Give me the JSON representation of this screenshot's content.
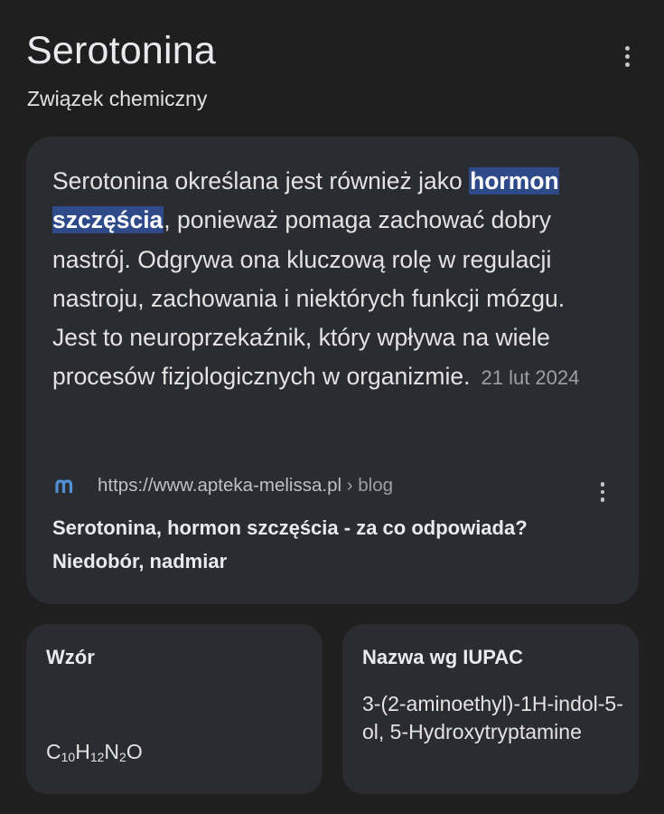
{
  "header": {
    "title": "Serotonina",
    "subtitle": "Związek chemiczny",
    "more_icon": "more-vert-icon"
  },
  "description": {
    "before_highlight": "Serotonina określana jest również jako ",
    "highlight": "hormon szczęścia",
    "after_highlight": ", ponieważ pomaga zachować dobry nastrój. Odgrywa ona kluczową rolę w regulacji nastroju, zachowania i niektórych funkcji mózgu. Jest to neuroprzekaźnik, który wpływa na wiele procesów fizjologicznych w organizmie.",
    "date": "21 lut 2024"
  },
  "source": {
    "logo_icon": "site-m-logo-icon",
    "logo_color": "#4f8fd6",
    "url_base": "https://www.apteka-melissa.pl",
    "url_path": " › blog",
    "article_title": "Serotonina, hormon szczęścia - za co odpowiada? Niedobór, nadmiar"
  },
  "facts": {
    "formula_label": "Wzór",
    "formula_parts": {
      "c": "C",
      "c_n": "10",
      "h": "H",
      "h_n": "12",
      "n": "N",
      "n_n": "2",
      "o": "O"
    },
    "iupac_label": "Nazwa wg IUPAC",
    "iupac_value": "3-(2-aminoethyl)-1H-indol-5-ol, 5-Hydroxytryptamine"
  },
  "colors": {
    "background": "#1f1f1f",
    "card": "#2a2c31",
    "highlight_bg": "#2f4a89"
  }
}
